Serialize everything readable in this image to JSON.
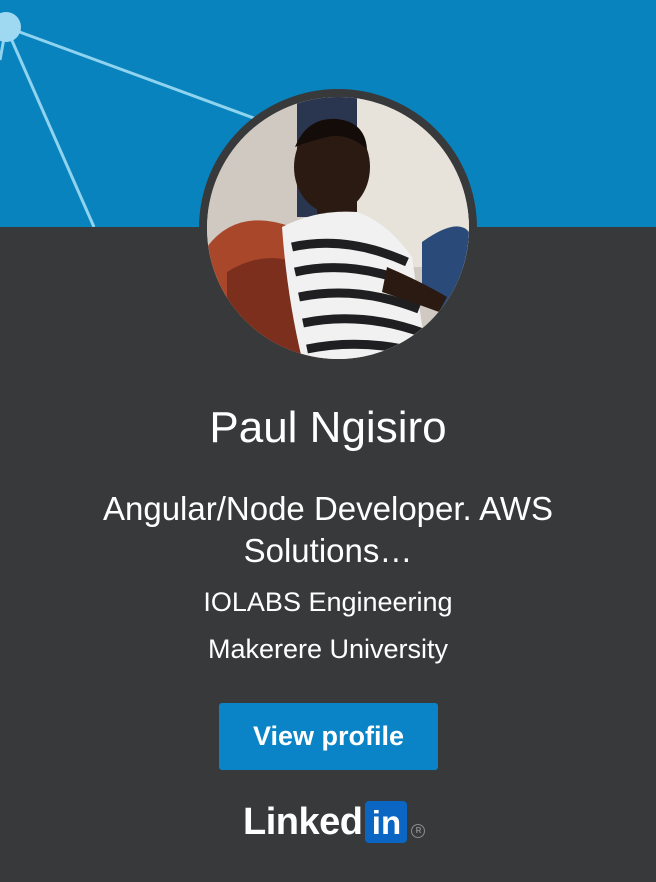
{
  "profile": {
    "name": "Paul Ngisiro",
    "headline": "Angular/Node Developer. AWS Solutions…",
    "company": "IOLABS Engineering",
    "school": "Makerere University"
  },
  "actions": {
    "view_profile_label": "View profile"
  },
  "brand": {
    "word": "Linked",
    "box": "in",
    "registered": "R"
  },
  "icons": {
    "avatar": "profile-photo",
    "banner": "network-lines-pattern",
    "logo": "linkedin-logo"
  },
  "colors": {
    "banner": "#0883bd",
    "card_background": "#38393b",
    "button": "#0a84c6",
    "linkedin_box": "#0a66c2",
    "text": "#ffffff"
  }
}
